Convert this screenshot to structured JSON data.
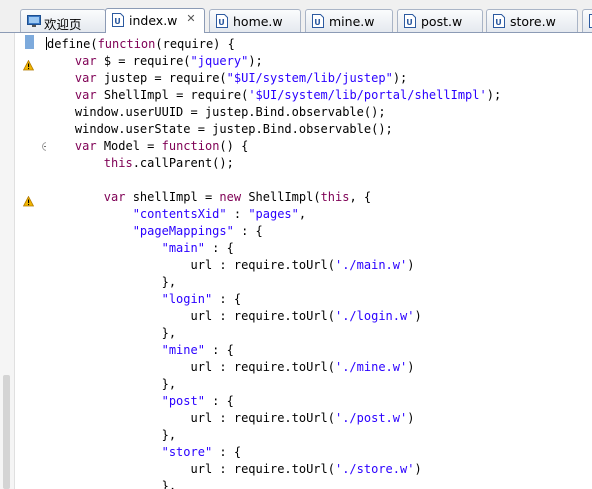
{
  "tabs": [
    {
      "label": "欢迎页",
      "icon": "monitor-icon",
      "active": false
    },
    {
      "label": "index.w",
      "icon": "w-file-icon",
      "active": true
    },
    {
      "label": "home.w",
      "icon": "w-file-icon",
      "active": false
    },
    {
      "label": "mine.w",
      "icon": "w-file-icon",
      "active": false
    },
    {
      "label": "post.w",
      "icon": "w-file-icon",
      "active": false
    },
    {
      "label": "store.w",
      "icon": "w-file-icon",
      "active": false
    }
  ],
  "gutter": {
    "warning_lines": [
      2,
      10
    ],
    "fold_lines": [
      7
    ]
  },
  "code_lines": [
    [
      {
        "t": "define("
      },
      {
        "t": "function",
        "k": "kw"
      },
      {
        "t": "(require) {"
      }
    ],
    [
      {
        "t": "    "
      },
      {
        "t": "var",
        "k": "kw"
      },
      {
        "t": " $ = require("
      },
      {
        "t": "\"jquery\"",
        "k": "str"
      },
      {
        "t": ");"
      }
    ],
    [
      {
        "t": "    "
      },
      {
        "t": "var",
        "k": "kw"
      },
      {
        "t": " justep = require("
      },
      {
        "t": "\"$UI/system/lib/justep\"",
        "k": "str"
      },
      {
        "t": ");"
      }
    ],
    [
      {
        "t": "    "
      },
      {
        "t": "var",
        "k": "kw"
      },
      {
        "t": " ShellImpl = require("
      },
      {
        "t": "'$UI/system/lib/portal/shellImpl'",
        "k": "str"
      },
      {
        "t": ");"
      }
    ],
    [
      {
        "t": "    window.userUUID = justep.Bind.observable();"
      }
    ],
    [
      {
        "t": "    window.userState = justep.Bind.observable();"
      }
    ],
    [
      {
        "t": "    "
      },
      {
        "t": "var",
        "k": "kw"
      },
      {
        "t": " Model = "
      },
      {
        "t": "function",
        "k": "kw"
      },
      {
        "t": "() {"
      }
    ],
    [
      {
        "t": "        "
      },
      {
        "t": "this",
        "k": "kw"
      },
      {
        "t": ".callParent();"
      }
    ],
    [
      {
        "t": ""
      }
    ],
    [
      {
        "t": "        "
      },
      {
        "t": "var",
        "k": "kw"
      },
      {
        "t": " shellImpl = "
      },
      {
        "t": "new",
        "k": "kw"
      },
      {
        "t": " ShellImpl("
      },
      {
        "t": "this",
        "k": "kw"
      },
      {
        "t": ", {"
      }
    ],
    [
      {
        "t": "            "
      },
      {
        "t": "\"contentsXid\"",
        "k": "str"
      },
      {
        "t": " : "
      },
      {
        "t": "\"pages\"",
        "k": "str"
      },
      {
        "t": ","
      }
    ],
    [
      {
        "t": "            "
      },
      {
        "t": "\"pageMappings\"",
        "k": "str"
      },
      {
        "t": " : {"
      }
    ],
    [
      {
        "t": "                "
      },
      {
        "t": "\"main\"",
        "k": "str"
      },
      {
        "t": " : {"
      }
    ],
    [
      {
        "t": "                    url : require.toUrl("
      },
      {
        "t": "'./main.w'",
        "k": "str"
      },
      {
        "t": ")"
      }
    ],
    [
      {
        "t": "                },"
      }
    ],
    [
      {
        "t": "                "
      },
      {
        "t": "\"login\"",
        "k": "str"
      },
      {
        "t": " : {"
      }
    ],
    [
      {
        "t": "                    url : require.toUrl("
      },
      {
        "t": "'./login.w'",
        "k": "str"
      },
      {
        "t": ")"
      }
    ],
    [
      {
        "t": "                },"
      }
    ],
    [
      {
        "t": "                "
      },
      {
        "t": "\"mine\"",
        "k": "str"
      },
      {
        "t": " : {"
      }
    ],
    [
      {
        "t": "                    url : require.toUrl("
      },
      {
        "t": "'./mine.w'",
        "k": "str"
      },
      {
        "t": ")"
      }
    ],
    [
      {
        "t": "                },"
      }
    ],
    [
      {
        "t": "                "
      },
      {
        "t": "\"post\"",
        "k": "str"
      },
      {
        "t": " : {"
      }
    ],
    [
      {
        "t": "                    url : require.toUrl("
      },
      {
        "t": "'./post.w'",
        "k": "str"
      },
      {
        "t": ")"
      }
    ],
    [
      {
        "t": "                },"
      }
    ],
    [
      {
        "t": "                "
      },
      {
        "t": "\"store\"",
        "k": "str"
      },
      {
        "t": " : {"
      }
    ],
    [
      {
        "t": "                    url : require.toUrl("
      },
      {
        "t": "'./store.w'",
        "k": "str"
      },
      {
        "t": ")"
      }
    ],
    [
      {
        "t": "                },"
      }
    ]
  ],
  "colors": {
    "keyword": "#7f0055",
    "string": "#2a00ff",
    "tab_border": "#8c9bb5",
    "warning": "#f0b400"
  }
}
